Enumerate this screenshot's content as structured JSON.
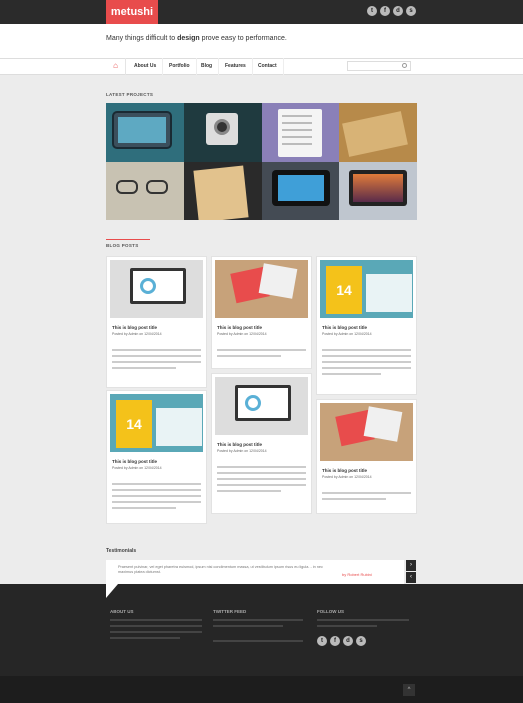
{
  "brand": {
    "logo": "metushi",
    "accent": "#e84c4c"
  },
  "tagline": {
    "pre": "Many things difficult to ",
    "emph": "design",
    "post": " prove easy to performance."
  },
  "nav": {
    "home_icon": "home-icon",
    "items": [
      "About Us",
      "Portfolio",
      "Blog",
      "Features",
      "Contact"
    ]
  },
  "social_icons": [
    "twitter-icon",
    "facebook-icon",
    "dribbble-icon",
    "skype-icon"
  ],
  "projects": {
    "title": "LATEST PROJECTS"
  },
  "blog": {
    "title": "BLOG POSTS",
    "posts": [
      {
        "title": "This is blog post title",
        "meta": "Posted by Admin on 12/04/2014"
      },
      {
        "title": "This is blog post title",
        "meta": "Posted by Admin on 12/04/2014"
      },
      {
        "title": "This is blog post title",
        "meta": "Posted by Admin on 12/04/2014"
      },
      {
        "title": "This is blog post title",
        "meta": "Posted by Admin on 12/04/2014"
      },
      {
        "title": "This is blog post title",
        "meta": "Posted by Admin on 12/04/2014"
      },
      {
        "title": "This is blog post title",
        "meta": "Posted by Admin on 12/04/2014"
      }
    ]
  },
  "testimonials": {
    "title": "Testimonials",
    "quote": "Praesent pulvinar, vel eget pharetra euismod, ipsum nisi condimentum massa, ut vestibulum ipsum risus eu ligula. - in nec maximus platea dictumst.",
    "author": "by Robert Rubini"
  },
  "footer": {
    "about_title": "ABOUT US",
    "twitter_title": "TWITTER FEED",
    "follow_title": "FOLLOW US"
  }
}
